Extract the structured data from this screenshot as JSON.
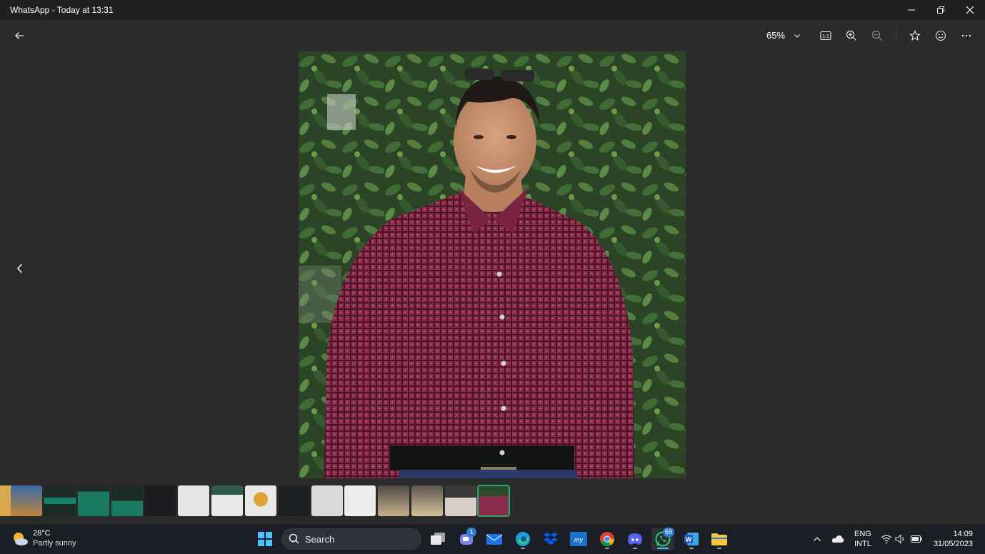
{
  "window": {
    "title": "WhatsApp - Today at 13:31",
    "controls": [
      "minimize-icon",
      "restore-icon",
      "close-icon"
    ]
  },
  "toolbar": {
    "back_icon": "arrow-left-icon",
    "zoom_value": "65%",
    "zoom_dropdown_icon": "chevron-down-icon",
    "actions": [
      "actual-size-icon",
      "zoom-in-icon",
      "zoom-out-icon",
      "favorite-star-icon",
      "emoji-icon",
      "more-icon"
    ]
  },
  "viewer": {
    "previous_icon": "chevron-left-icon",
    "photo_subject": "portrait-photo"
  },
  "filmstrip": {
    "thumbnail_count": 16,
    "selected_index": 15
  },
  "taskbar": {
    "weather": {
      "temperature": "28°C",
      "condition": "Partly sunny"
    },
    "search_label": "Search",
    "apps": [
      "windows-start",
      "search",
      "task-view",
      "teams-chat",
      "mail",
      "edge",
      "dropbox",
      "mylife",
      "chrome",
      "discord",
      "whatsapp",
      "word",
      "file-explorer"
    ],
    "teams_badge": "1",
    "whatsapp_badge": "69",
    "language": {
      "line1": "ENG",
      "line2": "INTL"
    },
    "clock": {
      "time": "14:09",
      "date": "31/05/2023"
    }
  },
  "colors": {
    "background": "#2b2b2b",
    "titlebar": "#202020",
    "taskbar": "#1c1e26",
    "accent_green": "#2ea873",
    "shirt": "#8a2c4c"
  }
}
